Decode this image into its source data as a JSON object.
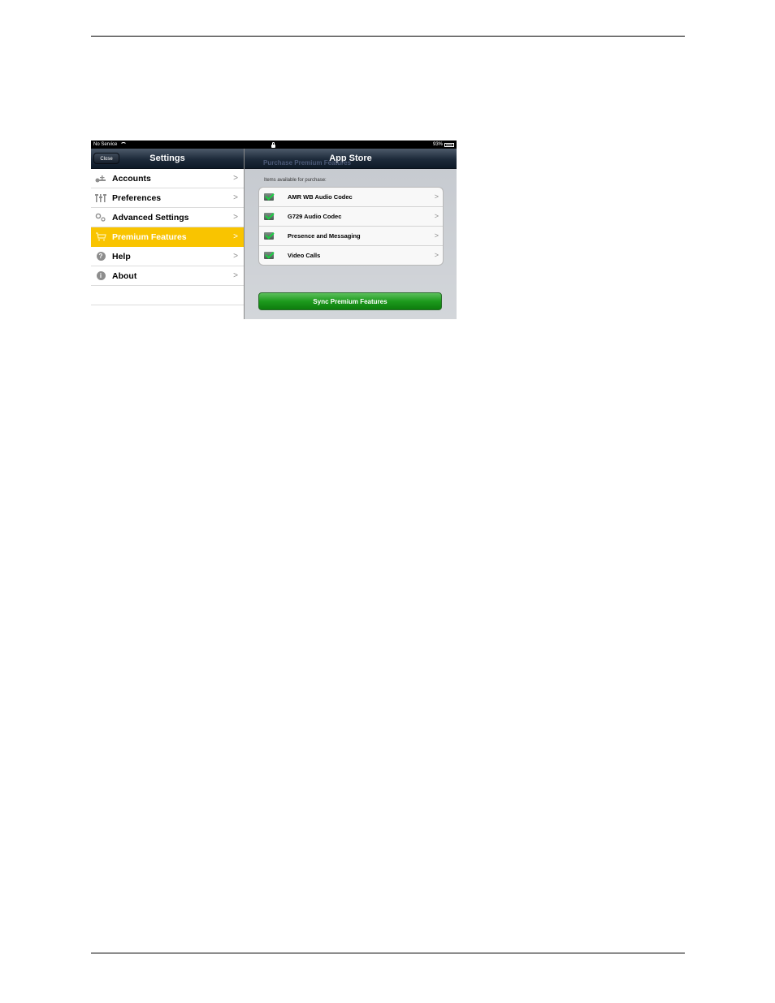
{
  "statusbar": {
    "carrier": "No Service",
    "battery": "93%",
    "icons": [
      "wifi-icon",
      "lock-icon",
      "battery-icon"
    ]
  },
  "left_pane": {
    "close_label": "Close",
    "title": "Settings",
    "menu": [
      {
        "label": "Accounts",
        "icon": "accounts-icon"
      },
      {
        "label": "Preferences",
        "icon": "preferences-icon"
      },
      {
        "label": "Advanced Settings",
        "icon": "gears-icon"
      },
      {
        "label": "Premium Features",
        "icon": "cart-icon",
        "selected": true
      },
      {
        "label": "Help",
        "icon": "help-icon"
      },
      {
        "label": "About",
        "icon": "info-icon"
      }
    ],
    "chevron": ">"
  },
  "right_pane": {
    "title": "App Store",
    "section_title": "Purchase Premium Features",
    "section_subtitle": "Items available for purchase:",
    "items": [
      {
        "label": "AMR WB Audio Codec",
        "checked": true
      },
      {
        "label": "G729 Audio Codec",
        "checked": true
      },
      {
        "label": "Presence and Messaging",
        "checked": true
      },
      {
        "label": "Video Calls",
        "checked": true
      }
    ],
    "sync_button": "Sync Premium Features"
  },
  "colors": {
    "selected": "#f9c400",
    "navbar": "#1d2a3a",
    "sync_green": "#1d9a1d",
    "section_title": "#4c5a78"
  }
}
